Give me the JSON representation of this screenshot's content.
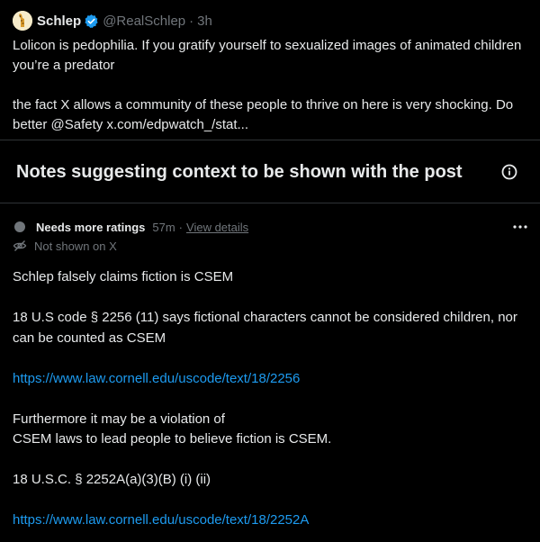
{
  "post": {
    "author_name": "Schlep",
    "handle": "@RealSchlep",
    "time": "3h",
    "separator": "·",
    "paragraph_1": "Lolicon is pedophilia. If you gratify yourself to sexualized images of animated children you’re a predator",
    "paragraph_2": "the fact X allows a community of these people to thrive on here is very shocking. Do better @Safety x.com/edpwatch_/stat..."
  },
  "notes_section": {
    "title": "Notes suggesting context to be shown with the post"
  },
  "note": {
    "status": "Needs more ratings",
    "time": "57m",
    "separator": "·",
    "details_link": "View details",
    "visibility": "Not shown on X",
    "body": {
      "line_1": "Schlep falsely claims fiction is CSEM",
      "line_2": "18 U.S code § 2256 (11) says fictional characters cannot be considered children, nor can be counted as CSEM",
      "link_1": "https://www.law.cornell.edu/uscode/text/18/2256",
      "line_3a": "Furthermore it may be a violation of",
      "line_3b": "CSEM laws to lead people to believe fiction is CSEM.",
      "line_4": "18 U.S.C. § 2252A(a)(3)(B) (i) (ii)",
      "link_2": "https://www.law.cornell.edu/uscode/text/18/2252A"
    }
  },
  "colors": {
    "background": "#000000",
    "text": "#e7e9ea",
    "muted": "#71767b",
    "link": "#1d9bf0",
    "verified": "#1d9bf0",
    "divider": "#2f3336"
  },
  "icons": {
    "avatar": "giraffe-avatar",
    "verified": "verified-badge-icon",
    "info": "info-icon",
    "more": "more-horizontal-icon",
    "not_shown": "eye-slash-icon",
    "status_dot": "status-dot-icon"
  }
}
